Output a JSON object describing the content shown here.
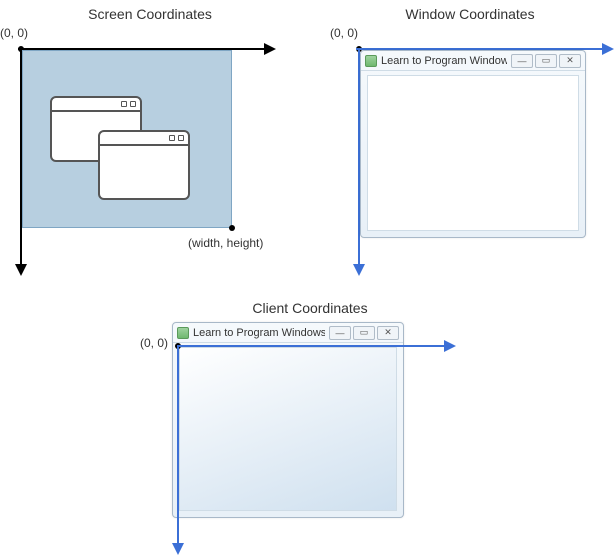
{
  "screen": {
    "title": "Screen Coordinates",
    "origin": "(0, 0)",
    "corner": "(width, height)"
  },
  "window": {
    "title": "Window Coordinates",
    "origin": "(0, 0)",
    "win_title": "Learn to Program Windows"
  },
  "client": {
    "title": "Client Coordinates",
    "origin": "(0, 0)",
    "win_title": "Learn to Program Windows"
  },
  "icons": {
    "minimize": "—",
    "maximize": "▭",
    "close": "✕"
  }
}
